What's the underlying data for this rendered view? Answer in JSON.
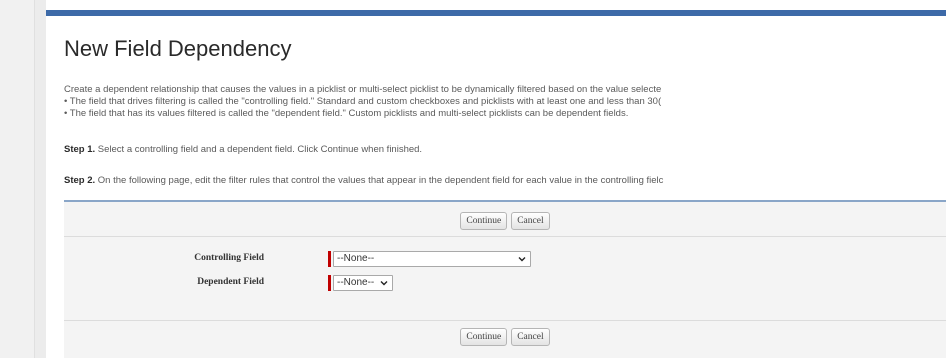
{
  "page": {
    "title": "New Field Dependency",
    "intro_lines": [
      "Create a dependent relationship that causes the values in a picklist or multi-select picklist to be dynamically filtered based on the value selecte",
      "• The field that drives filtering is called the \"controlling field.\" Standard and custom checkboxes and picklists with at least one and less than 30(",
      "• The field that has its values filtered is called the \"dependent field.\" Custom picklists and multi-select picklists can be dependent fields."
    ],
    "step1_label": "Step 1.",
    "step1_text": " Select a controlling field and a dependent field. Click Continue when finished.",
    "step2_label": "Step 2.",
    "step2_text": " On the following page, edit the filter rules that control the values that appear in the dependent field for each value in the controlling fielc"
  },
  "buttons": {
    "continue": "Continue",
    "cancel": "Cancel"
  },
  "fields": {
    "controlling_label": "Controlling Field",
    "controlling_value": "--None--",
    "dependent_label": "Dependent Field",
    "dependent_value": "--None--"
  },
  "colors": {
    "header_bar": "#3d6aa8",
    "required_marker": "#c00000"
  }
}
